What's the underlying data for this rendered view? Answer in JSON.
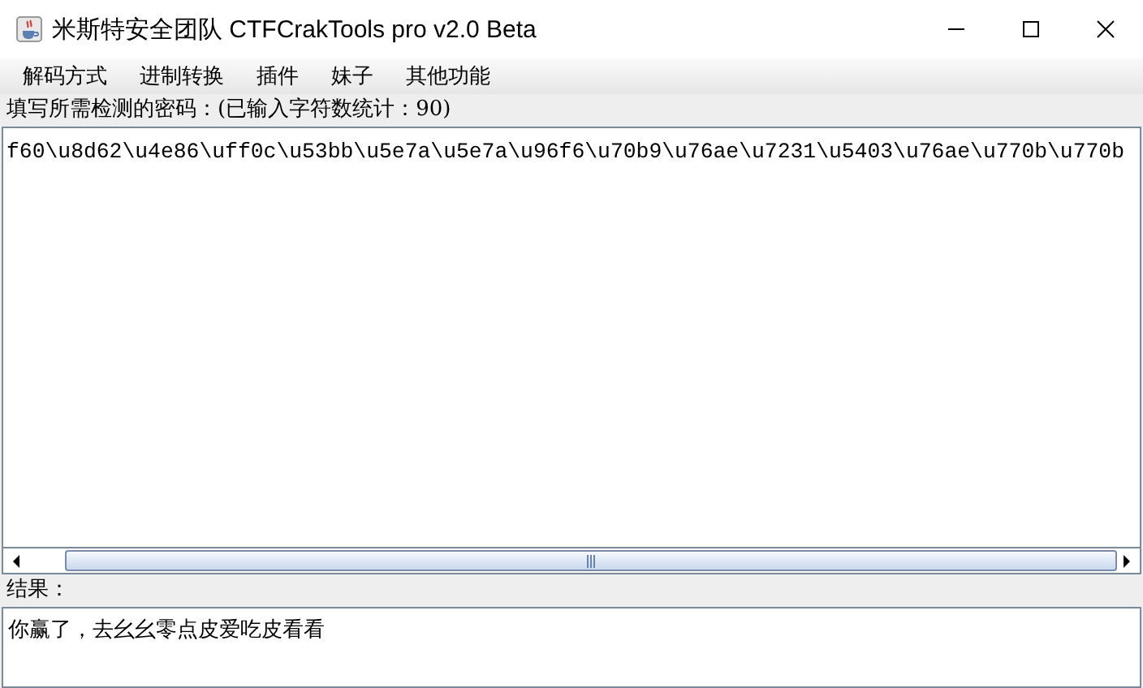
{
  "window": {
    "title": "米斯特安全团队 CTFCrakTools pro v2.0 Beta"
  },
  "menu": [
    "解码方式",
    "进制转换",
    "插件",
    "妹子",
    "其他功能"
  ],
  "input": {
    "label": "填写所需检测的密码：(已输入字符数统计：90)",
    "value": "f60\\u8d62\\u4e86\\uff0c\\u53bb\\u5e7a\\u5e7a\\u96f6\\u70b9\\u76ae\\u7231\\u5403\\u76ae\\u770b\\u770b"
  },
  "result": {
    "label": "结果：",
    "value": "你赢了，去幺幺零点皮爱吃皮看看"
  }
}
